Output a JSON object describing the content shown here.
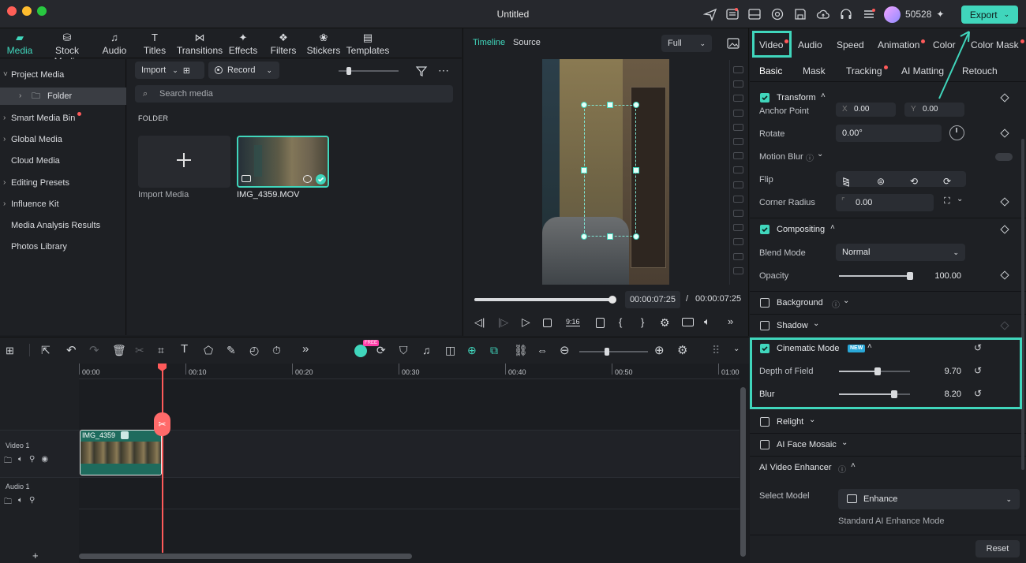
{
  "window": {
    "title": "Untitled"
  },
  "header": {
    "credits": "50528",
    "export_label": "Export"
  },
  "media_tabs": [
    {
      "label": "Media",
      "icon": "media-folder-icon",
      "active": true
    },
    {
      "label": "Stock Media",
      "icon": "stock-media-icon"
    },
    {
      "label": "Audio",
      "icon": "music-note-icon"
    },
    {
      "label": "Titles",
      "icon": "titles-T-icon"
    },
    {
      "label": "Transitions",
      "icon": "transitions-icon"
    },
    {
      "label": "Effects",
      "icon": "effects-sparkle-icon"
    },
    {
      "label": "Filters",
      "icon": "filters-icon"
    },
    {
      "label": "Stickers",
      "icon": "stickers-icon"
    },
    {
      "label": "Templates",
      "icon": "templates-icon"
    }
  ],
  "tree": [
    {
      "label": "Project Media",
      "caret": "˅"
    },
    {
      "label": "Folder",
      "caret": "›",
      "selected": true
    },
    {
      "label": "Smart Media Bin",
      "caret": "›",
      "dot": true
    },
    {
      "label": "Global Media",
      "caret": "›"
    },
    {
      "label": "Cloud Media",
      "caret": ""
    },
    {
      "label": "Editing Presets",
      "caret": "›"
    },
    {
      "label": "Influence Kit",
      "caret": "›"
    },
    {
      "label": "Media Analysis Results",
      "caret": ""
    },
    {
      "label": "Photos Library",
      "caret": ""
    }
  ],
  "media": {
    "import_label": "Import",
    "record_label": "Record",
    "search_placeholder": "Search media",
    "folder_heading": "FOLDER",
    "import_media_label": "Import Media",
    "clip_name": "IMG_4359.MOV"
  },
  "preview": {
    "tab_timeline": "Timeline",
    "tab_source": "Source",
    "zoom": "Full",
    "current_time": "00:00:07:25",
    "separator": "/",
    "total_time": "00:00:07:25",
    "ratio_label": "9:16",
    "progress": 1.0
  },
  "right_tabs": [
    {
      "label": "Video",
      "dot": true,
      "active": true
    },
    {
      "label": "Audio"
    },
    {
      "label": "Speed"
    },
    {
      "label": "Animation",
      "dot": true
    },
    {
      "label": "Color"
    },
    {
      "label": "Color Mask",
      "dot": true
    }
  ],
  "sub_tabs": [
    {
      "label": "Basic",
      "active": true
    },
    {
      "label": "Mask"
    },
    {
      "label": "Tracking",
      "dot": true
    },
    {
      "label": "AI Matting"
    },
    {
      "label": "Retouch"
    }
  ],
  "transform": {
    "title": "Transform",
    "anchor_label": "Anchor Point",
    "anchor_x_label": "X",
    "anchor_x": "0.00",
    "anchor_y_label": "Y",
    "anchor_y": "0.00",
    "rotate_label": "Rotate",
    "rotate_value": "0.00°",
    "motion_blur_label": "Motion Blur",
    "flip_label": "Flip",
    "corner_label": "Corner Radius",
    "corner_value": "0.00"
  },
  "compositing": {
    "title": "Compositing",
    "blend_label": "Blend Mode",
    "blend_value": "Normal",
    "opacity_label": "Opacity",
    "opacity_value": "100.00",
    "opacity_level": 1.0
  },
  "background": {
    "title": "Background"
  },
  "shadow": {
    "title": "Shadow"
  },
  "cinematic": {
    "title": "Cinematic Mode",
    "badge": "NEW",
    "dof_label": "Depth of Field",
    "dof_value": "9.70",
    "dof_level": 0.54,
    "blur_label": "Blur",
    "blur_value": "8.20",
    "blur_level": 0.78
  },
  "relight": {
    "title": "Relight"
  },
  "face_mosaic": {
    "title": "AI Face Mosaic"
  },
  "enhancer": {
    "title": "AI Video Enhancer",
    "model_label": "Select Model",
    "model_value": "Enhance",
    "mode_text": "Standard AI Enhance Mode"
  },
  "reset_label": "Reset",
  "timeline": {
    "ruler": [
      "00:00",
      "00:10",
      "00:20",
      "00:30",
      "00:40",
      "00:50",
      "01:00"
    ],
    "video_track": "Video 1",
    "audio_track": "Audio 1",
    "clip_label": "IMG_4359",
    "free_badge": "FREE"
  },
  "colors": {
    "accent": "#40d6bc",
    "playhead": "#ff5a5a"
  }
}
